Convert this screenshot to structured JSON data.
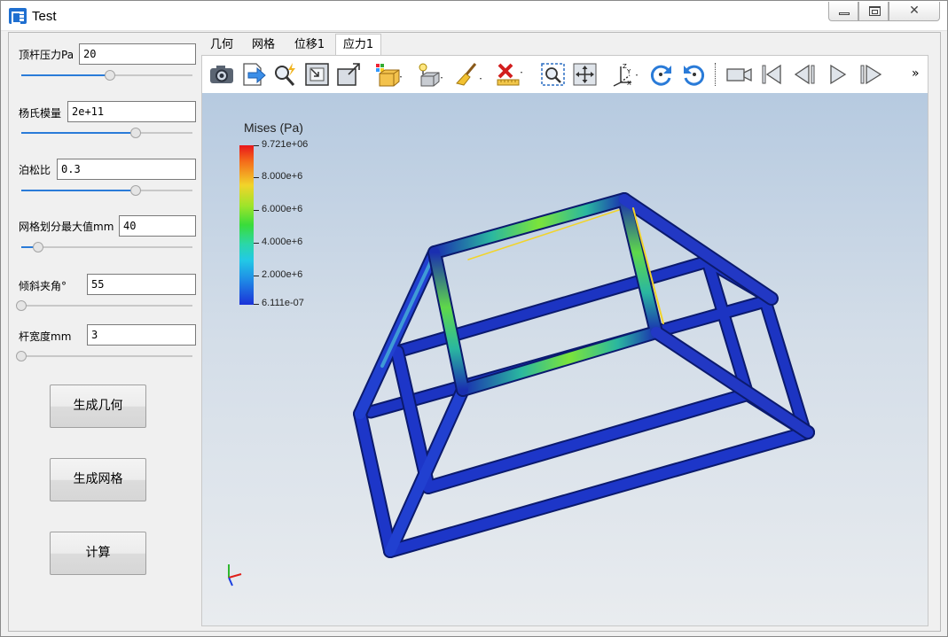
{
  "window": {
    "title": "Test",
    "min_icon": "minimize-icon",
    "max_icon": "maximize-icon",
    "close_icon": "close-icon",
    "close_glyph": "✕"
  },
  "params": [
    {
      "label": "顶杆压力Pa",
      "value": "20",
      "slider": 0.52
    },
    {
      "label": "杨氏模量",
      "value": "2e+11",
      "slider": 0.67
    },
    {
      "label": "泊松比",
      "value": "0.3",
      "slider": 0.67
    },
    {
      "label": "网格划分最大值mm",
      "value": "40",
      "slider": 0.1
    },
    {
      "label": "倾斜夹角°",
      "value": "55",
      "slider": 0.0
    },
    {
      "label": "杆宽度mm",
      "value": "3",
      "slider": 0.0
    }
  ],
  "actions": {
    "generate_geometry": "生成几何",
    "generate_mesh": "生成网格",
    "compute": "计算"
  },
  "tabs": [
    "几何",
    "网格",
    "位移1",
    "应力1"
  ],
  "active_tab": "应力1",
  "toolbar": {
    "icons": [
      "camera-icon",
      "export-icon",
      "probe-icon",
      "zoom-box-icon",
      "zoom-extents-icon",
      "color-map-icon",
      "surface-icon",
      "clear-brush-icon",
      "delete-icon",
      "select-region-icon",
      "fit-view-icon",
      "axes-icon",
      "rotate-cw-icon",
      "rotate-ccw-icon",
      "record-icon",
      "first-frame-icon",
      "prev-frame-icon",
      "play-icon",
      "next-frame-icon"
    ],
    "more": "»"
  },
  "legend": {
    "title": "Mises (Pa)",
    "labels": [
      "9.721e+06",
      "8.000e+6",
      "6.000e+6",
      "4.000e+6",
      "2.000e+6",
      "6.111e-07"
    ],
    "colors": {
      "high": "#e8151b",
      "mid": "#39dc3a",
      "low": "#1b32d8"
    }
  },
  "colors": {
    "frame_base": "#1a2fb0",
    "accent": "#2a7bd8"
  }
}
